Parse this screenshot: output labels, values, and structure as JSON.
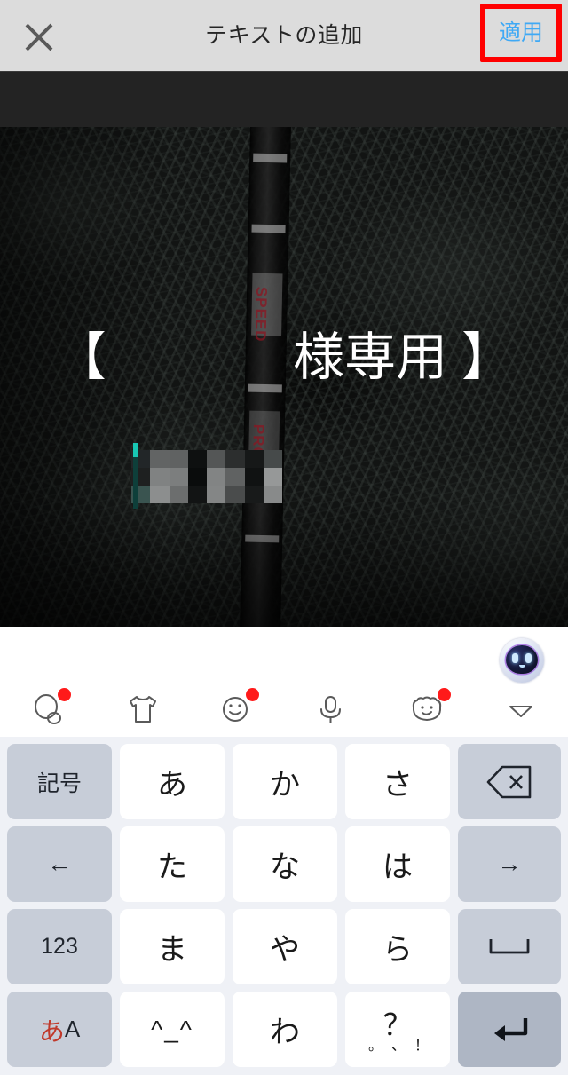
{
  "header": {
    "title": "テキストの追加",
    "close_icon": "close-x-icon",
    "apply_label": "適用",
    "apply_color": "#3fa9f5",
    "highlight_color": "#ff0000",
    "background_color": "#dcdcdc"
  },
  "canvas": {
    "overlay_text_prefix": "【",
    "overlay_text_redacted": "",
    "overlay_text_suffix": "様専用 】",
    "overlay_text_full": "【■■■様専用 】",
    "redaction_style": "mosaic-pixelation",
    "caret_color": "#18c8b4",
    "photo_description": "dark-fur-background-with-stick",
    "band_color": "#232323"
  },
  "keyboard": {
    "ai_button": {
      "icon": "ai-assistant-face-icon"
    },
    "toolbar": [
      {
        "icon": "sticker-bubble-icon",
        "badge": true,
        "badge_color": "#ff1a1a"
      },
      {
        "icon": "tshirt-theme-icon",
        "badge": false,
        "badge_color": "#ff1a1a"
      },
      {
        "icon": "emoji-smiley-icon",
        "badge": true,
        "badge_color": "#ff1a1a"
      },
      {
        "icon": "microphone-icon",
        "badge": false,
        "badge_color": "#ff1a1a"
      },
      {
        "icon": "bear-avatar-icon",
        "badge": true,
        "badge_color": "#ff1a1a"
      },
      {
        "icon": "chevron-down-icon",
        "badge": false,
        "badge_color": "#ff1a1a"
      }
    ],
    "rows": [
      [
        {
          "label": "記号",
          "type": "fn",
          "name": "symbols-key"
        },
        {
          "label": "あ",
          "type": "char",
          "name": "kana-a-key"
        },
        {
          "label": "か",
          "type": "char",
          "name": "kana-ka-key"
        },
        {
          "label": "さ",
          "type": "char",
          "name": "kana-sa-key"
        },
        {
          "label": "",
          "type": "fn",
          "name": "backspace-key",
          "icon": "backspace-icon"
        }
      ],
      [
        {
          "label": "←",
          "type": "fn",
          "name": "cursor-left-key"
        },
        {
          "label": "た",
          "type": "char",
          "name": "kana-ta-key"
        },
        {
          "label": "な",
          "type": "char",
          "name": "kana-na-key"
        },
        {
          "label": "は",
          "type": "char",
          "name": "kana-ha-key"
        },
        {
          "label": "→",
          "type": "fn",
          "name": "cursor-right-key"
        }
      ],
      [
        {
          "label": "123",
          "type": "fn",
          "name": "numeric-key"
        },
        {
          "label": "ま",
          "type": "char",
          "name": "kana-ma-key"
        },
        {
          "label": "や",
          "type": "char",
          "name": "kana-ya-key"
        },
        {
          "label": "ら",
          "type": "char",
          "name": "kana-ra-key"
        },
        {
          "label": "␣",
          "type": "fn",
          "name": "space-key"
        }
      ],
      [
        {
          "label": "あA",
          "type": "fn",
          "name": "input-mode-key"
        },
        {
          "label": "^_^",
          "type": "char",
          "name": "kaomoji-key"
        },
        {
          "label": "わ",
          "type": "char",
          "name": "kana-wa-key"
        },
        {
          "label": "？",
          "type": "char",
          "name": "punctuation-key"
        },
        {
          "label": "↵",
          "type": "enter",
          "name": "enter-key"
        }
      ]
    ],
    "punctuation_key": {
      "main": "？",
      "minor": [
        "。",
        "、",
        "！"
      ]
    },
    "mode_key": {
      "ja": "あ",
      "en": "A"
    },
    "kaomoji_label": "^_^",
    "colors": {
      "background": "#eff1f6",
      "char_key": "#ffffff",
      "fn_key": "#c7cdd8",
      "enter_key": "#aeb6c4"
    }
  }
}
